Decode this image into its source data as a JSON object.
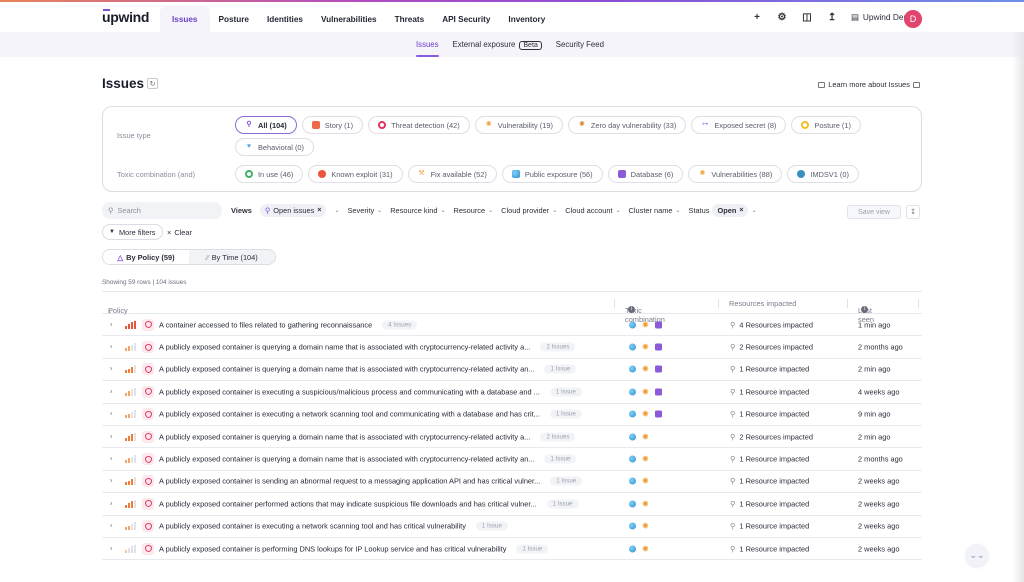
{
  "app": {
    "brand": "upwind",
    "accent_color": "#6b3fc7"
  },
  "topnav": {
    "items": [
      {
        "label": "Issues",
        "active": true
      },
      {
        "label": "Posture",
        "active": false
      },
      {
        "label": "Identities",
        "active": false
      },
      {
        "label": "Vulnerabilities",
        "active": false
      },
      {
        "label": "Threats",
        "active": false
      },
      {
        "label": "API Security",
        "active": false
      },
      {
        "label": "Inventory",
        "active": false
      }
    ],
    "icons": [
      "plus-icon",
      "gear-icon",
      "book-icon",
      "upload-icon"
    ],
    "org_name": "Upwind Demo",
    "avatar_initial": "D",
    "avatar_color": "#e0466d"
  },
  "subnav": {
    "items": [
      {
        "label": "Issues",
        "active": true
      },
      {
        "label": "External exposure",
        "badge": "Beta",
        "active": false
      },
      {
        "label": "Security Feed",
        "active": false
      }
    ]
  },
  "page": {
    "title": "Issues",
    "learn_more": "Learn more about Issues"
  },
  "filters": {
    "issue_type_label": "Issue type",
    "issue_types": [
      {
        "label": "All (104)",
        "icon": "search-icon",
        "selected": true
      },
      {
        "label": "Story (1)",
        "icon": "story-icon",
        "selected": false
      },
      {
        "label": "Threat detection (42)",
        "icon": "shield-icon",
        "selected": false
      },
      {
        "label": "Vulnerability (19)",
        "icon": "bug-icon",
        "selected": false
      },
      {
        "label": "Zero day vulnerability (33)",
        "icon": "bug-icon",
        "selected": false
      },
      {
        "label": "Exposed secret (8)",
        "icon": "key-icon",
        "selected": false
      },
      {
        "label": "Posture (1)",
        "icon": "posture-icon",
        "selected": false
      },
      {
        "label": "Behavioral (0)",
        "icon": "heart-icon",
        "selected": false
      }
    ],
    "toxic_label": "Toxic combination (and)",
    "toxic_combinations": [
      {
        "label": "In use (46)",
        "icon": "in-use-icon"
      },
      {
        "label": "Known exploit (31)",
        "icon": "exploit-icon"
      },
      {
        "label": "Fix available (52)",
        "icon": "wrench-icon"
      },
      {
        "label": "Public exposure (56)",
        "icon": "globe-icon"
      },
      {
        "label": "Database (6)",
        "icon": "database-icon"
      },
      {
        "label": "Vulnerabilities (88)",
        "icon": "bug-icon"
      },
      {
        "label": "IMDSV1 (0)",
        "icon": "imds-icon"
      }
    ]
  },
  "toolbar": {
    "search_placeholder": "Search",
    "views_label": "Views",
    "view_value": "Open issues",
    "dropdowns": [
      "Severity",
      "Resource kind",
      "Resource",
      "Cloud provider",
      "Cloud account",
      "Cluster name"
    ],
    "status_label": "Status",
    "status_value": "Open",
    "save_view": "Save view",
    "more_filters": "More filters",
    "clear": "Clear",
    "group_by": [
      {
        "label": "By Policy (59)",
        "active": true
      },
      {
        "label": "By Time (104)",
        "active": false
      }
    ],
    "showing": "Showing 59 rows | 104 issues"
  },
  "table": {
    "columns": {
      "policy": "Policy",
      "toxic": "Toxic combination",
      "resources": "Resources impacted",
      "last_seen": "Last seen"
    },
    "rows": [
      {
        "severity": 4,
        "policy": "A container accessed to files related to gathering reconnaissance",
        "count": "4 Issues",
        "toxic": [
          "globe",
          "bug",
          "db"
        ],
        "resources": "4 Resources impacted",
        "last_seen": "1 min ago"
      },
      {
        "severity": 2,
        "policy": "A publicly exposed container is querying a domain name that is associated with cryptocurrency-related activity a...",
        "count": "2 Issues",
        "toxic": [
          "globe",
          "bug",
          "db"
        ],
        "resources": "2 Resources impacted",
        "last_seen": "2 months ago"
      },
      {
        "severity": 3,
        "policy": "A publicly exposed container is querying a domain name that is associated with cryptocurrency-related activity an...",
        "count": "1 Issue",
        "toxic": [
          "globe",
          "bug",
          "db"
        ],
        "resources": "1 Resource impacted",
        "last_seen": "2 min ago"
      },
      {
        "severity": 2,
        "policy": "A publicly exposed container is executing a suspicious/malicious process and communicating with a database and ...",
        "count": "1 Issue",
        "toxic": [
          "globe",
          "bug",
          "db"
        ],
        "resources": "1 Resource impacted",
        "last_seen": "4 weeks ago"
      },
      {
        "severity": 2,
        "policy": "A publicly exposed container is executing a network scanning tool and communicating with a database and has crit...",
        "count": "1 Issue",
        "toxic": [
          "globe",
          "bug",
          "db"
        ],
        "resources": "1 Resource impacted",
        "last_seen": "9 min ago"
      },
      {
        "severity": 3,
        "policy": "A publicly exposed container is querying a domain name that is associated with cryptocurrency-related activity a...",
        "count": "2 Issues",
        "toxic": [
          "globe",
          "bug"
        ],
        "resources": "2 Resources impacted",
        "last_seen": "2 min ago"
      },
      {
        "severity": 2,
        "policy": "A publicly exposed container is querying a domain name that is associated with cryptocurrency-related activity an...",
        "count": "1 Issue",
        "toxic": [
          "globe",
          "bug"
        ],
        "resources": "1 Resource impacted",
        "last_seen": "2 months ago"
      },
      {
        "severity": 3,
        "policy": "A publicly exposed container is sending an abnormal request to a messaging application API and has critical vulner...",
        "count": "1 Issue",
        "toxic": [
          "globe",
          "bug"
        ],
        "resources": "1 Resource impacted",
        "last_seen": "2 weeks ago"
      },
      {
        "severity": 3,
        "policy": "A publicly exposed container performed actions that may indicate suspicious file downloads and has critical vulner...",
        "count": "1 Issue",
        "toxic": [
          "globe",
          "bug"
        ],
        "resources": "1 Resource impacted",
        "last_seen": "2 weeks ago"
      },
      {
        "severity": 2,
        "policy": "A publicly exposed container is executing a network scanning tool and has critical vulnerability",
        "count": "1 Issue",
        "toxic": [
          "globe",
          "bug"
        ],
        "resources": "1 Resource impacted",
        "last_seen": "2 weeks ago"
      },
      {
        "severity": 1,
        "policy": "A publicly exposed container is performing DNS lookups for IP Lookup service and has critical vulnerability",
        "count": "1 Issue",
        "toxic": [
          "globe",
          "bug"
        ],
        "resources": "1 Resource impacted",
        "last_seen": "2 weeks ago"
      }
    ]
  }
}
